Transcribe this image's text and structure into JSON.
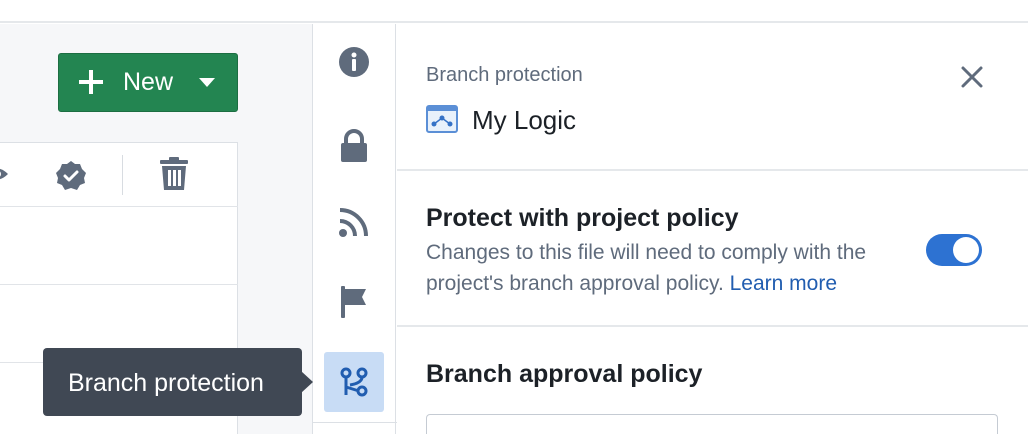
{
  "colors": {
    "primary_green": "#238551",
    "accent_blue": "#2d72d2",
    "link_blue": "#215db0",
    "icon_gray": "#5f6b7c",
    "tooltip_bg": "#404854",
    "active_rail_bg": "#c8dcf5"
  },
  "toolbar": {
    "new_label": "New",
    "new_icon": "plus-icon",
    "new_caret_icon": "caret-down-icon"
  },
  "table_header_icons": [
    "eye-icon",
    "badge-check-icon",
    "trash-icon"
  ],
  "rail": {
    "items": [
      {
        "icon": "info-icon",
        "active": false
      },
      {
        "icon": "lock-icon",
        "active": false
      },
      {
        "icon": "feed-icon",
        "active": false
      },
      {
        "icon": "flag-icon",
        "active": false
      },
      {
        "icon": "git-branch-icon",
        "active": true
      }
    ]
  },
  "tooltip": {
    "text": "Branch protection"
  },
  "panel": {
    "eyebrow": "Branch protection",
    "resource_name": "My Logic",
    "resource_icon": "logic-file-icon",
    "close_icon": "close-icon",
    "protect_section": {
      "title": "Protect with project policy",
      "description": "Changes to this file will need to comply with the project's branch approval policy.",
      "link": "Learn more",
      "toggle_on": true
    },
    "policy_section": {
      "title": "Branch approval policy"
    }
  }
}
